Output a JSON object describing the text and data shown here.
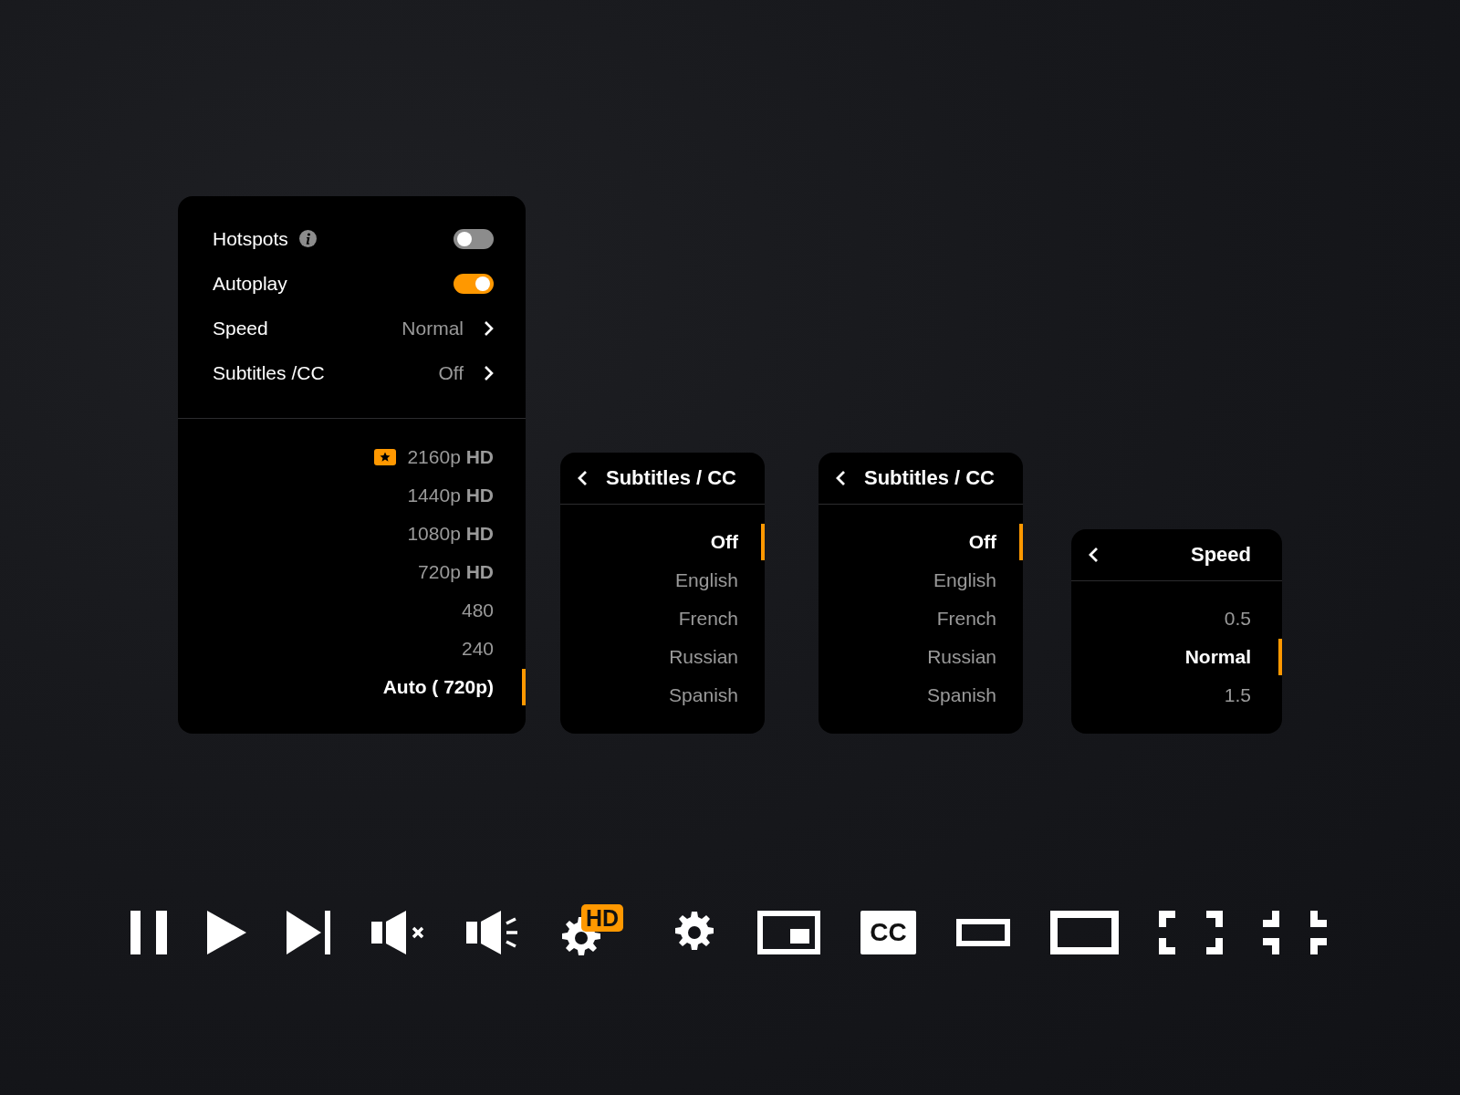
{
  "settings_panel": {
    "rows": [
      {
        "kind": "toggle",
        "label": "Hotspots",
        "info_icon": true,
        "on": false
      },
      {
        "kind": "toggle",
        "label": "Autoplay",
        "info_icon": false,
        "on": true
      },
      {
        "kind": "submenu",
        "label": "Speed",
        "value": "Normal"
      },
      {
        "kind": "submenu",
        "label": "Subtitles /CC",
        "value": "Off"
      }
    ],
    "quality": [
      {
        "label": "2160p **HD**",
        "premium": true,
        "selected": false
      },
      {
        "label": "1440p **HD**",
        "premium": false,
        "selected": false
      },
      {
        "label": "1080p **HD**",
        "premium": false,
        "selected": false
      },
      {
        "label": "720p **HD**",
        "premium": false,
        "selected": false
      },
      {
        "label": "480",
        "premium": false,
        "selected": false
      },
      {
        "label": "240",
        "premium": false,
        "selected": false
      },
      {
        "label": "Auto ( 720p)",
        "premium": false,
        "selected": true
      }
    ]
  },
  "submenus": [
    {
      "kind": "subtitles",
      "title": "Subtitles / CC",
      "options": [
        {
          "label": "Off",
          "selected": true
        },
        {
          "label": "English",
          "selected": false
        },
        {
          "label": "French",
          "selected": false
        },
        {
          "label": "Russian",
          "selected": false
        },
        {
          "label": "Spanish",
          "selected": false
        }
      ]
    },
    {
      "kind": "subtitles",
      "title": "Subtitles / CC",
      "options": [
        {
          "label": "Off",
          "selected": true
        },
        {
          "label": "English",
          "selected": false
        },
        {
          "label": "French",
          "selected": false
        },
        {
          "label": "Russian",
          "selected": false
        },
        {
          "label": "Spanish",
          "selected": false
        }
      ]
    },
    {
      "kind": "speed",
      "title": "Speed",
      "options": [
        {
          "label": "0.5",
          "selected": false
        },
        {
          "label": "Normal",
          "selected": true
        },
        {
          "label": "1.5",
          "selected": false
        }
      ]
    }
  ],
  "controls": [
    {
      "kind": "pause"
    },
    {
      "kind": "play"
    },
    {
      "kind": "next"
    },
    {
      "kind": "mute"
    },
    {
      "kind": "volume"
    },
    {
      "kind": "settings",
      "badge": "HD"
    },
    {
      "kind": "settings"
    },
    {
      "kind": "pip"
    },
    {
      "kind": "captions",
      "label": "CC"
    },
    {
      "kind": "small-player"
    },
    {
      "kind": "large-player"
    },
    {
      "kind": "fullscreen"
    },
    {
      "kind": "exit-fullscreen"
    }
  ]
}
